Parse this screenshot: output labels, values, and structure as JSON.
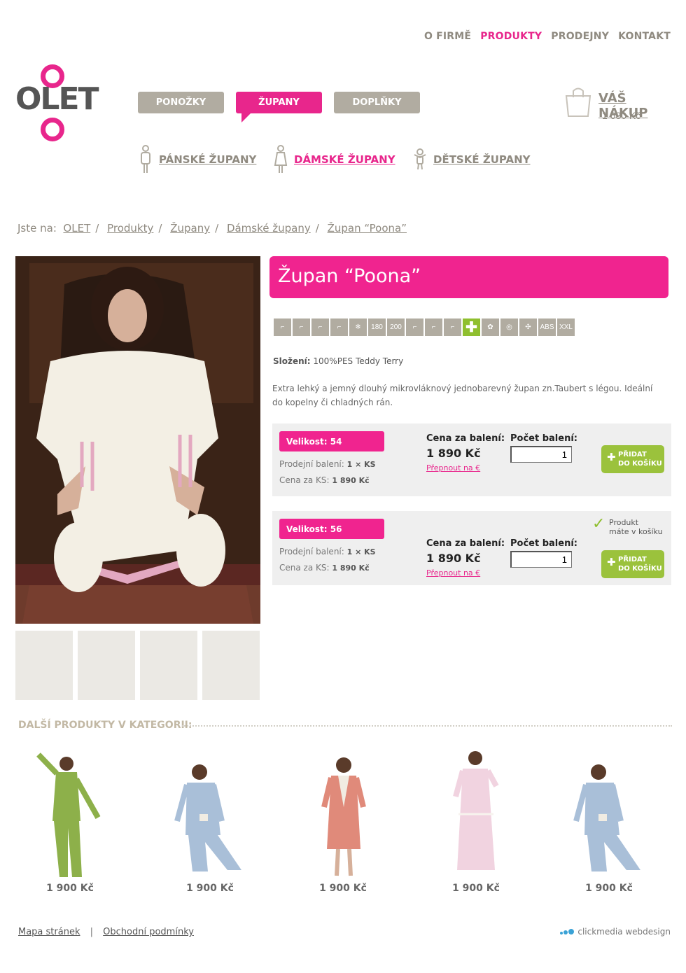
{
  "top_menu": [
    {
      "label": "O FIRMĚ",
      "active": false
    },
    {
      "label": "PRODUKTY",
      "active": true
    },
    {
      "label": "PRODEJNY",
      "active": false
    },
    {
      "label": "KONTAKT",
      "active": false
    }
  ],
  "logo": {
    "text": "OLET"
  },
  "tabs": [
    {
      "label": "PONOŽKY",
      "active": false
    },
    {
      "label": "ŽUPANY",
      "active": true
    },
    {
      "label": "DOPLŇKY",
      "active": false
    }
  ],
  "cart": {
    "title": "VÁŠ NÁKUP",
    "total": "1 680 Kč",
    "icon": "shopping-bag-icon"
  },
  "submenu": [
    {
      "label": "PÁNSKÉ ŽUPANY",
      "icon": "man-icon",
      "active": false
    },
    {
      "label": "DÁMSKÉ ŽUPANY",
      "icon": "woman-icon",
      "active": true
    },
    {
      "label": "DĚTSKÉ ŽUPANY",
      "icon": "child-icon",
      "active": false
    }
  ],
  "breadcrumb": {
    "prefix": "Jste na:",
    "items": [
      "OLET",
      "Produkty",
      "Župany",
      "Dámské župany",
      "Župan “Poona”"
    ]
  },
  "product": {
    "title": "Župan “Poona”",
    "icons": [
      "sock-icon",
      "sock-icon",
      "sock-icon",
      "sock-icon",
      "snowflake-icon",
      "180-icon",
      "200-icon",
      "sock-icon",
      "sock-icon",
      "sock-icon",
      "plus-icon",
      "cotton-icon",
      "spiral-icon",
      "arrows-icon",
      "abs-icon",
      "xxl-icon"
    ],
    "icon_labels": {
      "180": "180",
      "200": "200",
      "abs": "ABS",
      "xxl": "XXL",
      "plus": "✚"
    },
    "composition_label": "Složení:",
    "composition_value": "100%PES Teddy Terry",
    "description": "Extra lehký a jemný dlouhý mikrovláknový jednobarevný župan zn.Taubert s légou. Ideální do kopelny či chladných rán."
  },
  "variants": [
    {
      "size_label": "Velikost: 54",
      "pack_label": "Prodejní balení:",
      "pack_value": "1 × KS",
      "unit_label": "Cena za KS:",
      "unit_value": "1 890 Kč",
      "price_label": "Cena za balení:",
      "price_value": "1 890 Kč",
      "switch_label": "Přepnout na €",
      "qty_label": "Počet balení:",
      "qty_value": "1",
      "button_label_1": "PŘIDAT",
      "button_label_2": "DO KOŠÍKU"
    },
    {
      "size_label": "Velikost: 56",
      "pack_label": "Prodejní balení:",
      "pack_value": "1 × KS",
      "unit_label": "Cena za KS:",
      "unit_value": "1 890 Kč",
      "price_label": "Cena za balení:",
      "price_value": "1 890 Kč",
      "switch_label": "Přepnout na €",
      "qty_label": "Počet balení:",
      "qty_value": "1",
      "button_label_1": "PŘIDAT",
      "button_label_2": "DO KOŠÍKU",
      "in_cart_1": "Produkt",
      "in_cart_2": "máte v košíku"
    }
  ],
  "related": {
    "heading": "DALŠÍ PRODUKTY V KATEGORII:",
    "items": [
      {
        "price": "1 900 Kč",
        "color": "#8db04a"
      },
      {
        "price": "1 900 Kč",
        "color": "#a9bfd8"
      },
      {
        "price": "1 900 Kč",
        "color": "#e08a7a"
      },
      {
        "price": "1 900 Kč",
        "color": "#f1d3e0"
      },
      {
        "price": "1 900 Kč",
        "color": "#a9bfd8"
      }
    ]
  },
  "footer": {
    "links": [
      "Mapa stránek",
      "Obchodní podmínky"
    ],
    "credit": "clickmedia webdesign"
  },
  "colors": {
    "accent": "#e8268c",
    "neutral": "#b1aca1",
    "green": "#9bc23c"
  }
}
